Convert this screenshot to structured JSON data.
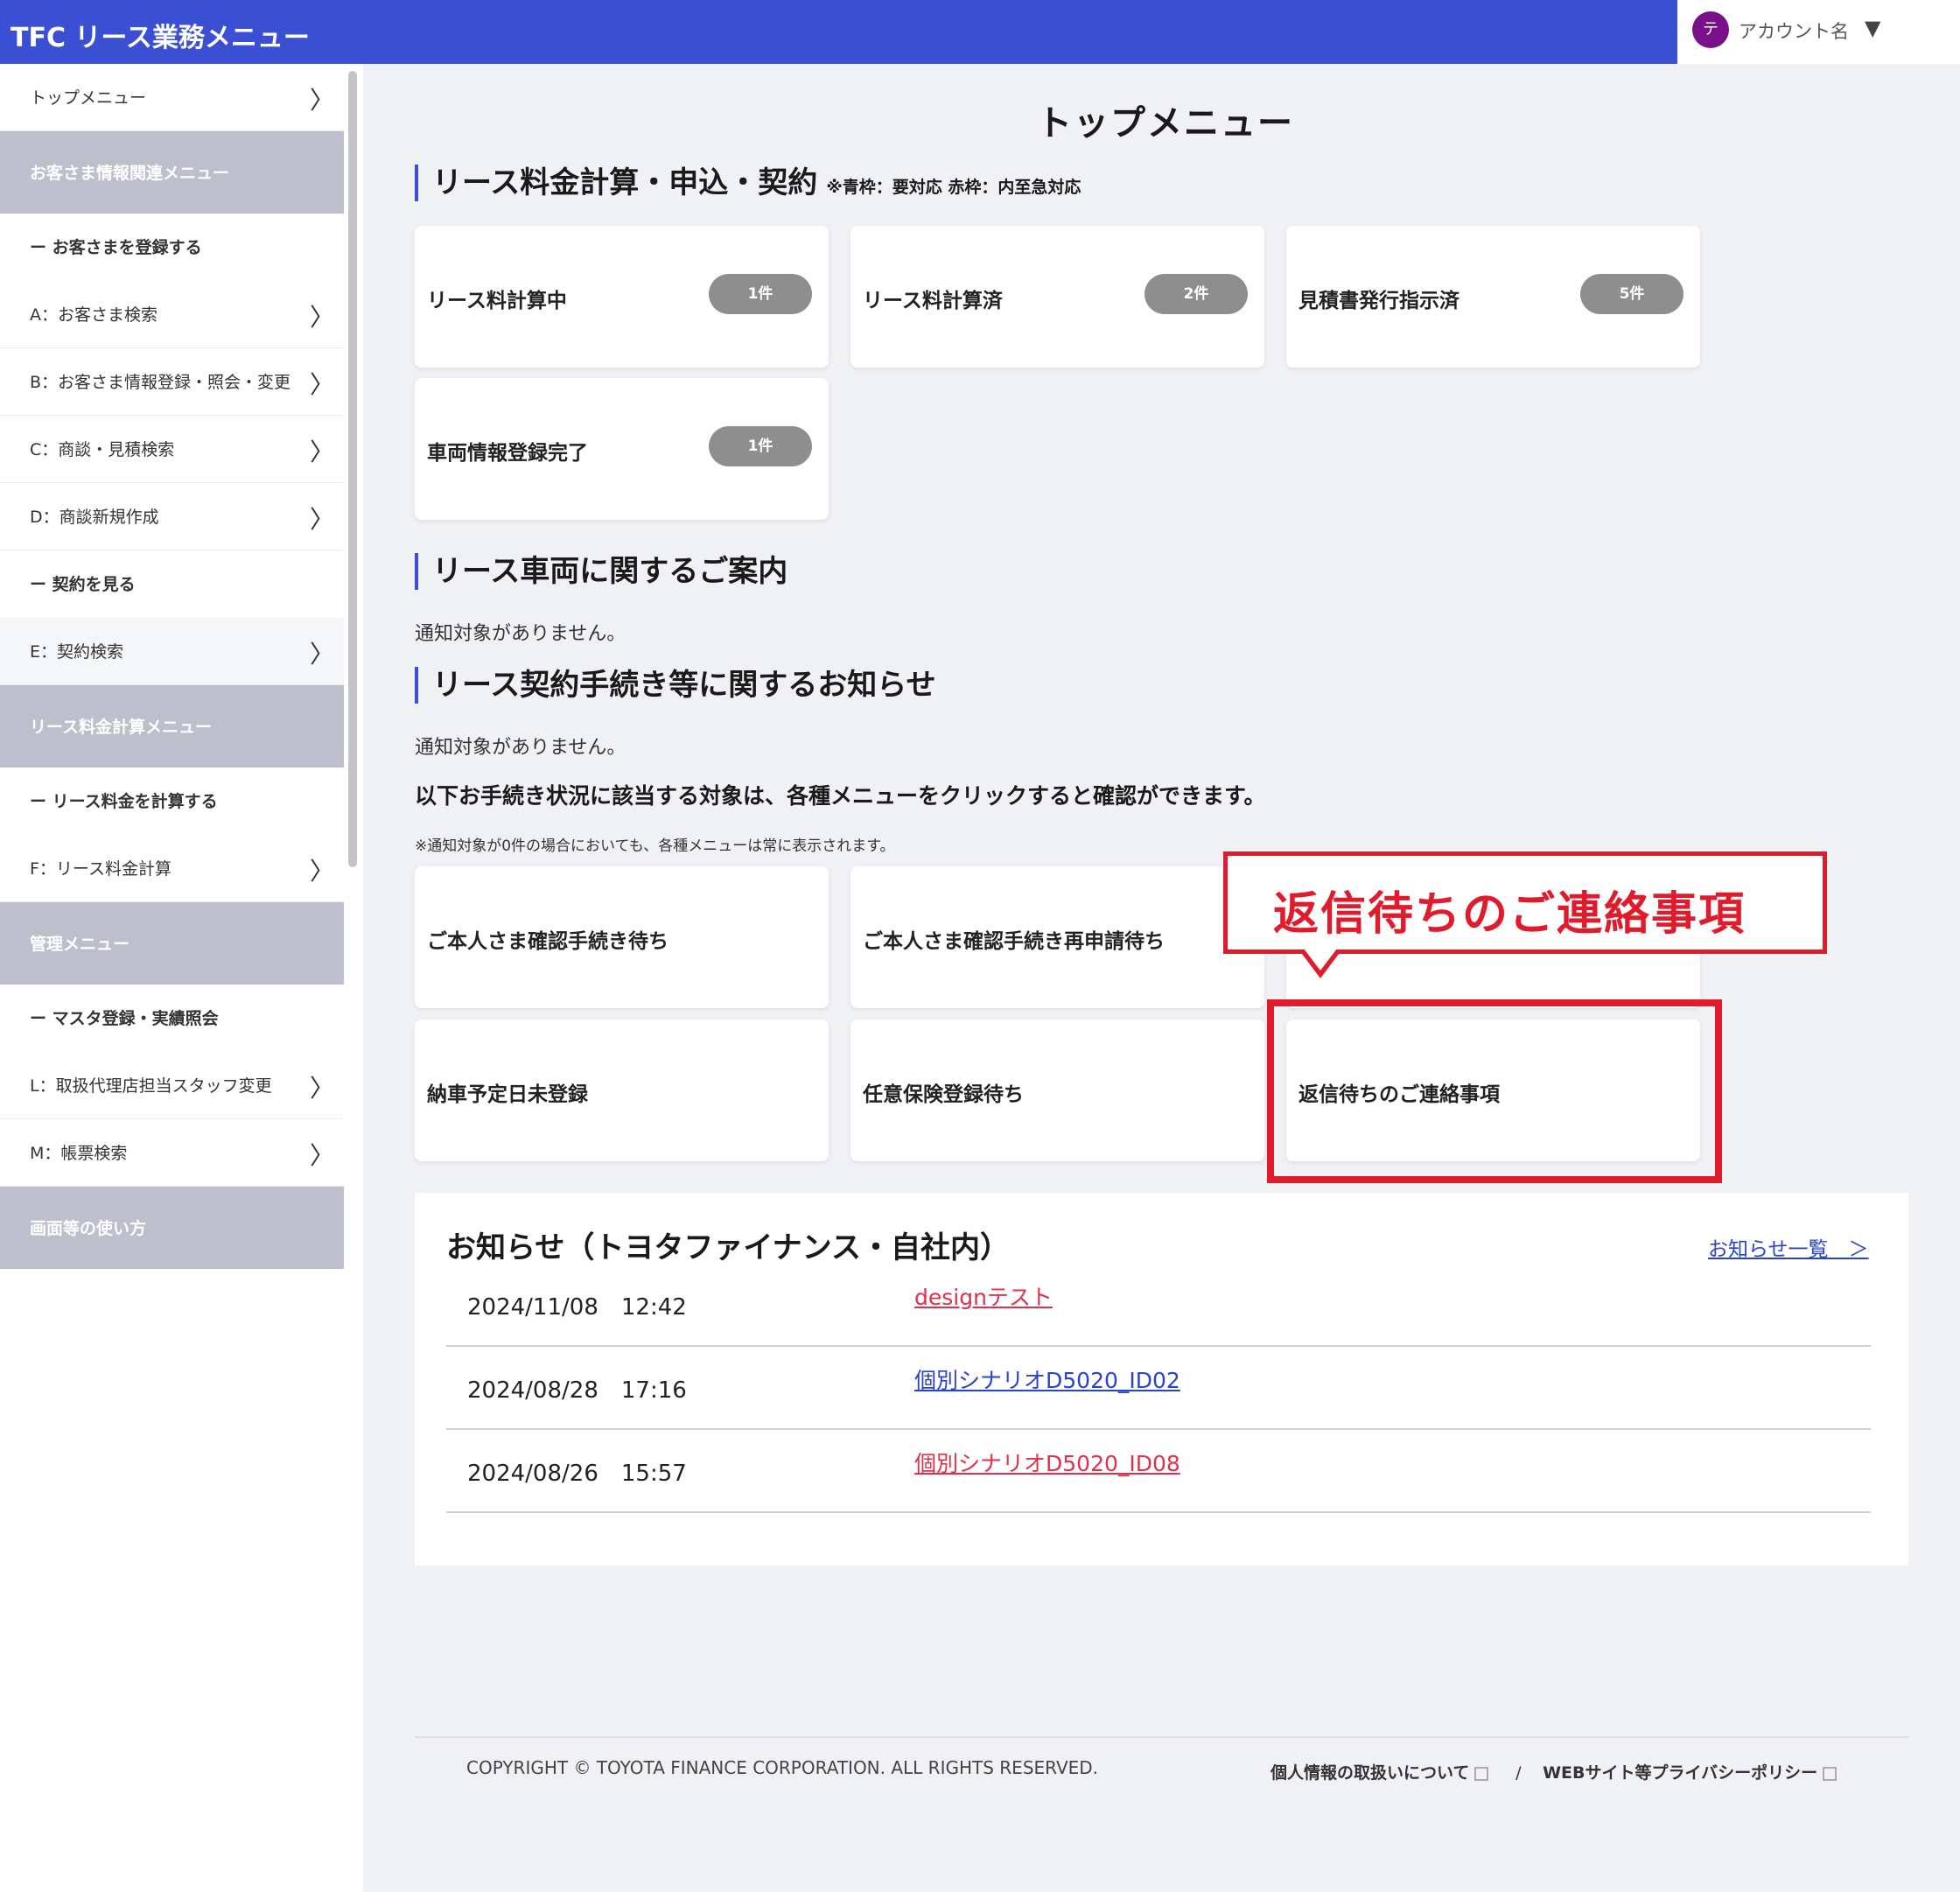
{
  "header": {
    "app_title": "TFC リース業務メニュー",
    "account_initial": "テ",
    "account_name": "アカウント名",
    "account_caret": "▼"
  },
  "sidebar": {
    "top_menu": "トップメニュー",
    "customer_group": "お客さま情報関連メニュー",
    "register_customer": "ー お客さまを登録する",
    "item_a": "A：お客さま検索",
    "item_b": "B：お客さま情報登録・照会・変更",
    "item_c": "C：商談・見積検索",
    "item_d": "D：商談新規作成",
    "view_contract": "ー 契約を見る",
    "item_e": "E：契約検索",
    "lease_group": "リース料金計算メニュー",
    "calc_lease": "ー リース料金を計算する",
    "item_f": "F：リース料金計算",
    "admin_group": "管理メニュー",
    "master_reg": "ー マスタ登録・実績照会",
    "item_l": "L：取扱代理店担当スタッフ変更",
    "item_m": "M：帳票検索",
    "usage_group": "画面等の使い方",
    "chevron": "〉"
  },
  "main": {
    "page_title": "トップメニュー",
    "section1_title": "リース料金計算・申込・契約",
    "section1_note": "※青枠：要対応 赤枠：内至急対応",
    "cards1": [
      {
        "label": "リース料計算中",
        "badge": "1件"
      },
      {
        "label": "リース料計算済",
        "badge": "2件"
      },
      {
        "label": "見積書発行指示済",
        "badge": "5件"
      },
      {
        "label": "車両情報登録完了",
        "badge": "1件"
      }
    ],
    "section2_title": "リース車両に関するご案内",
    "section2_empty": "通知対象がありません。",
    "section3_title": "リース契約手続き等に関するお知らせ",
    "section3_empty": "通知対象がありません。",
    "instruction": "以下お手続き状況に該当する対象は、各種メニューをクリックすると確認ができます。",
    "instruction_note": "※通知対象が0件の場合においても、各種メニューは常に表示されます。",
    "cards2": [
      {
        "label": "ご本人さま確認手続き待ち"
      },
      {
        "label": "ご本人さま確認手続き再申請待ち"
      },
      {
        "label": "納車予定日未登録"
      },
      {
        "label": "任意保険登録待ち"
      },
      {
        "label": "返信待ちのご連絡事項"
      }
    ],
    "callout_text": "返信待ちのご連絡事項"
  },
  "news": {
    "title": "お知らせ（トヨタファイナンス・自社内）",
    "list_link": "お知らせ一覧　＞",
    "rows": [
      {
        "date": "2024/11/08　12:42",
        "text": "designテスト",
        "color": "#e0304a"
      },
      {
        "date": "2024/08/28　17:16",
        "text": "個別シナリオD5020_ID02",
        "color": "#2a44c8"
      },
      {
        "date": "2024/08/26　15:57",
        "text": "個別シナリオD5020_ID08",
        "color": "#e0304a"
      }
    ]
  },
  "footer": {
    "copyright": "COPYRIGHT © TOYOTA FINANCE CORPORATION. ALL RIGHTS RESERVED.",
    "privacy_link": "個人情報の取扱いについて",
    "separator": "/",
    "web_policy_link": "WEBサイト等プライバシーポリシー"
  },
  "colors": {
    "header_bg": "#3b4fd4",
    "accent_red": "#e01b2b",
    "badge_gray": "#8e8e8e"
  }
}
